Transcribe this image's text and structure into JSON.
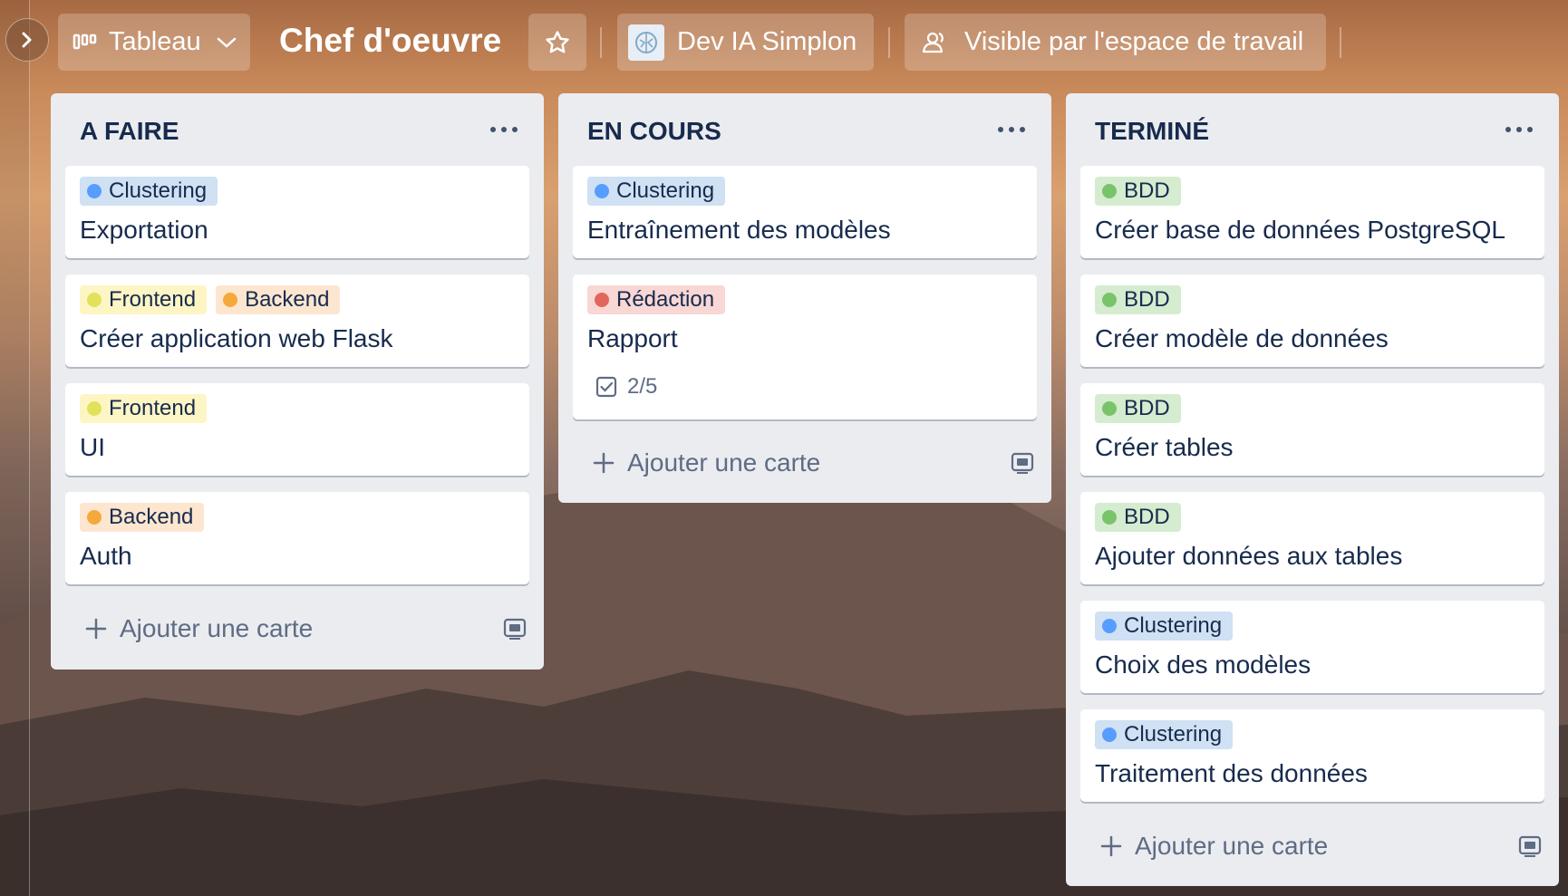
{
  "header": {
    "view_button": "Tableau",
    "board_title": "Chef d'oeuvre",
    "workspace_button": "Dev IA Simplon",
    "visibility_button": "Visible par l'espace de travail"
  },
  "colors": {
    "clustering": "#cfe1f3",
    "clustering_dot": "#579dff",
    "frontend": "#fdf5c4",
    "frontend_dot": "#e2e25a",
    "backend": "#fde6cf",
    "backend_dot": "#f5a93a",
    "redaction": "#f8d7d4",
    "redaction_dot": "#e2665d",
    "bdd": "#d5ecd0",
    "bdd_dot": "#79c46a"
  },
  "lists": [
    {
      "title": "A FAIRE",
      "cards": [
        {
          "labels": [
            "Clustering"
          ],
          "title": "Exportation"
        },
        {
          "labels": [
            "Frontend",
            "Backend"
          ],
          "title": "Créer application web Flask"
        },
        {
          "labels": [
            "Frontend"
          ],
          "title": "UI"
        },
        {
          "labels": [
            "Backend"
          ],
          "title": "Auth"
        }
      ],
      "add_card": "Ajouter une carte"
    },
    {
      "title": "EN COURS",
      "cards": [
        {
          "labels": [
            "Clustering"
          ],
          "title": "Entraînement des modèles"
        },
        {
          "labels": [
            "Rédaction"
          ],
          "title": "Rapport",
          "checklist": "2/5"
        }
      ],
      "add_card": "Ajouter une carte"
    },
    {
      "title": "TERMINÉ",
      "cards": [
        {
          "labels": [
            "BDD"
          ],
          "title": "Créer base de données PostgreSQL"
        },
        {
          "labels": [
            "BDD"
          ],
          "title": "Créer modèle de données"
        },
        {
          "labels": [
            "BDD"
          ],
          "title": "Créer tables"
        },
        {
          "labels": [
            "BDD"
          ],
          "title": "Ajouter données aux tables"
        },
        {
          "labels": [
            "Clustering"
          ],
          "title": "Choix des modèles"
        },
        {
          "labels": [
            "Clustering"
          ],
          "title": "Traitement des données"
        }
      ],
      "add_card": "Ajouter une carte"
    }
  ]
}
